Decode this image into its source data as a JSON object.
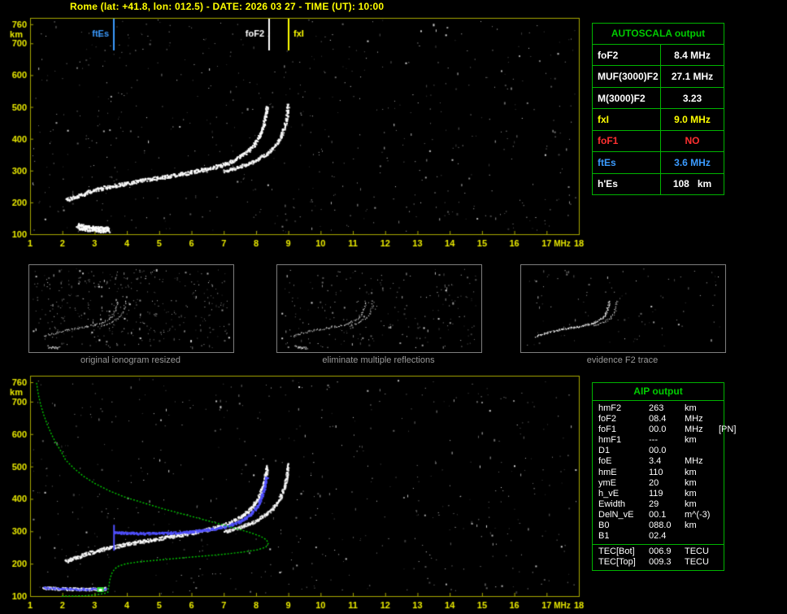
{
  "title": "Rome (lat: +41.8, lon: 012.5) - DATE: 2026 03 27 - TIME (UT): 10:00",
  "colors": {
    "axis": "#a8a800",
    "axis_label": "#e8e800",
    "title_yellow": "#ffff00",
    "green": "#00cc00",
    "table_border_green": "#00b400",
    "red": "#ff3030",
    "blue": "#3b9bff",
    "trace_blue": "#5050ff",
    "white": "#ffffff",
    "caption_gray": "#9a9a9a"
  },
  "chart_data": [
    {
      "id": "ionogram",
      "type": "scatter",
      "xlabel": "MHz",
      "ylabel": "km",
      "xlim": [
        1,
        18
      ],
      "ylim": [
        100,
        780
      ],
      "xticks": [
        1,
        2,
        3,
        4,
        5,
        6,
        7,
        8,
        9,
        10,
        11,
        12,
        13,
        14,
        15,
        16,
        17,
        18
      ],
      "yticks": [
        100,
        200,
        300,
        400,
        500,
        600,
        700,
        760
      ],
      "grid": false,
      "legend": "none",
      "markers": [
        {
          "label": "ftEs",
          "freq_mhz": 3.6,
          "color": "#3b9bff",
          "label_side": "left"
        },
        {
          "label": "foF2",
          "freq_mhz": 8.4,
          "color": "#ffffff",
          "label_side": "left"
        },
        {
          "label": "fxI",
          "freq_mhz": 9.0,
          "color": "#ffff00",
          "label_side": "right"
        }
      ],
      "traces": {
        "f2_ordinary": [
          [
            2.1,
            208
          ],
          [
            2.4,
            220
          ],
          [
            2.7,
            231
          ],
          [
            3.0,
            240
          ],
          [
            3.3,
            248
          ],
          [
            3.6,
            254
          ],
          [
            3.9,
            260
          ],
          [
            4.2,
            266
          ],
          [
            4.5,
            271
          ],
          [
            4.8,
            276
          ],
          [
            5.1,
            281
          ],
          [
            5.4,
            286
          ],
          [
            5.7,
            291
          ],
          [
            6.0,
            297
          ],
          [
            6.3,
            303
          ],
          [
            6.6,
            310
          ],
          [
            6.9,
            318
          ],
          [
            7.15,
            327
          ],
          [
            7.38,
            338
          ],
          [
            7.58,
            350
          ],
          [
            7.75,
            364
          ],
          [
            7.9,
            380
          ],
          [
            8.02,
            398
          ],
          [
            8.12,
            418
          ],
          [
            8.2,
            440
          ],
          [
            8.26,
            462
          ],
          [
            8.3,
            484
          ],
          [
            8.33,
            505
          ]
        ],
        "f2_extraordinary": [
          [
            7.0,
            300
          ],
          [
            7.3,
            308
          ],
          [
            7.6,
            318
          ],
          [
            7.9,
            330
          ],
          [
            8.15,
            344
          ],
          [
            8.38,
            360
          ],
          [
            8.55,
            378
          ],
          [
            8.7,
            398
          ],
          [
            8.8,
            420
          ],
          [
            8.88,
            444
          ],
          [
            8.93,
            468
          ],
          [
            8.96,
            492
          ],
          [
            8.98,
            512
          ]
        ],
        "sporadic_e": [
          [
            2.45,
            127
          ],
          [
            2.65,
            122
          ],
          [
            2.85,
            119
          ],
          [
            3.05,
            117
          ],
          [
            3.25,
            116
          ],
          [
            3.45,
            116
          ]
        ]
      }
    },
    {
      "id": "profile_ionogram",
      "type": "scatter",
      "xlabel": "MHz",
      "ylabel": "km",
      "xlim": [
        1,
        18
      ],
      "ylim": [
        100,
        780
      ],
      "xticks": [
        1,
        2,
        3,
        4,
        5,
        6,
        7,
        8,
        9,
        10,
        11,
        12,
        13,
        14,
        15,
        16,
        17,
        18
      ],
      "yticks": [
        100,
        200,
        300,
        400,
        500,
        600,
        700,
        760
      ],
      "grid": false,
      "legend": "none",
      "electron_density_profile": [
        [
          1.2,
          758
        ],
        [
          1.26,
          720
        ],
        [
          1.33,
          690
        ],
        [
          1.42,
          660
        ],
        [
          1.53,
          630
        ],
        [
          1.66,
          600
        ],
        [
          1.8,
          572
        ],
        [
          1.97,
          545
        ],
        [
          2.1,
          520
        ],
        [
          2.35,
          495
        ],
        [
          2.65,
          470
        ],
        [
          3.0,
          448
        ],
        [
          3.45,
          425
        ],
        [
          3.95,
          405
        ],
        [
          4.5,
          388
        ],
        [
          5.1,
          370
        ],
        [
          5.7,
          354
        ],
        [
          6.3,
          338
        ],
        [
          6.9,
          322
        ],
        [
          7.4,
          308
        ],
        [
          7.85,
          295
        ],
        [
          8.15,
          284
        ],
        [
          8.32,
          274
        ],
        [
          8.38,
          263
        ],
        [
          8.3,
          251
        ],
        [
          8.05,
          243
        ],
        [
          7.6,
          236
        ],
        [
          7.0,
          229
        ],
        [
          6.3,
          223
        ],
        [
          5.6,
          217
        ],
        [
          4.95,
          211
        ],
        [
          4.4,
          206
        ],
        [
          3.98,
          200
        ],
        [
          3.75,
          193
        ],
        [
          3.62,
          184
        ],
        [
          3.54,
          172
        ],
        [
          3.49,
          158
        ],
        [
          3.46,
          144
        ],
        [
          3.44,
          130
        ],
        [
          3.42,
          120
        ],
        [
          3.41,
          112
        ],
        [
          3.3,
          108
        ],
        [
          3.05,
          104
        ],
        [
          2.7,
          101
        ],
        [
          2.3,
          100
        ],
        [
          1.95,
          100
        ]
      ],
      "scaled_trace": [
        [
          3.6,
          298
        ],
        [
          4.0,
          296
        ],
        [
          4.4,
          295
        ],
        [
          4.8,
          295
        ],
        [
          5.2,
          296
        ],
        [
          5.6,
          298
        ],
        [
          6.0,
          301
        ],
        [
          6.4,
          305
        ],
        [
          6.8,
          311
        ],
        [
          7.1,
          318
        ],
        [
          7.4,
          328
        ],
        [
          7.65,
          341
        ],
        [
          7.85,
          357
        ],
        [
          8.0,
          376
        ],
        [
          8.12,
          398
        ],
        [
          8.21,
          422
        ],
        [
          8.28,
          448
        ],
        [
          8.32,
          472
        ]
      ],
      "es_trace": [
        [
          1.4,
          127
        ],
        [
          1.75,
          125
        ],
        [
          2.1,
          124
        ],
        [
          2.45,
          123
        ],
        [
          2.8,
          123
        ],
        [
          3.1,
          124
        ],
        [
          3.35,
          125
        ]
      ],
      "ftes_marker": {
        "freq_mhz": 3.6,
        "km_from": 240,
        "km_to": 320
      },
      "es_peak_marker": {
        "freq_mhz": 3.18,
        "km": 120
      }
    }
  ],
  "thumbnails": [
    {
      "caption": "original ionogram resized"
    },
    {
      "caption": "eliminate multiple reflections"
    },
    {
      "caption": "evidence F2 trace"
    }
  ],
  "autoscala_table": {
    "title": "AUTOSCALA output",
    "rows": [
      {
        "label": "foF2",
        "value": "8.4 MHz",
        "color": "#ffffff"
      },
      {
        "label": "MUF(3000)F2",
        "value": "27.1 MHz",
        "color": "#ffffff"
      },
      {
        "label": "M(3000)F2",
        "value": "3.23",
        "color": "#ffffff"
      },
      {
        "label": "fxI",
        "value": "9.0 MHz",
        "color": "#ffff00"
      },
      {
        "label": "foF1",
        "value": "NO",
        "color": "#ff3030"
      },
      {
        "label": "ftEs",
        "value": "3.6 MHz",
        "color": "#3b9bff"
      },
      {
        "label": "h'Es",
        "value": "108   km",
        "color": "#ffffff"
      }
    ]
  },
  "aip_table": {
    "title": "AIP output",
    "rows": [
      {
        "name": "hmF2",
        "value": "263",
        "unit": "km",
        "note": ""
      },
      {
        "name": "foF2",
        "value": "08.4",
        "unit": "MHz",
        "note": ""
      },
      {
        "name": "foF1",
        "value": "00.0",
        "unit": "MHz",
        "note": "[PN]"
      },
      {
        "name": "hmF1",
        "value": "---",
        "unit": "km",
        "note": ""
      },
      {
        "name": "D1",
        "value": "00.0",
        "unit": "",
        "note": ""
      },
      {
        "name": "foE",
        "value": "3.4",
        "unit": "MHz",
        "note": ""
      },
      {
        "name": "hmE",
        "value": "110",
        "unit": "km",
        "note": ""
      },
      {
        "name": "ymE",
        "value": "20",
        "unit": "km",
        "note": ""
      },
      {
        "name": "h_vE",
        "value": "119",
        "unit": "km",
        "note": ""
      },
      {
        "name": "Ewidth",
        "value": "29",
        "unit": "km",
        "note": ""
      },
      {
        "name": "DelN_vE",
        "value": "00.1",
        "unit": "m^(-3)",
        "note": ""
      },
      {
        "name": "B0",
        "value": "088.0",
        "unit": "km",
        "note": ""
      },
      {
        "name": "B1",
        "value": "02.4",
        "unit": "",
        "note": ""
      }
    ],
    "tec_rows": [
      {
        "name": "TEC[Bot]",
        "value": "006.9",
        "unit": "TECU",
        "note": ""
      },
      {
        "name": "TEC[Top]",
        "value": "009.3",
        "unit": "TECU",
        "note": ""
      }
    ]
  }
}
